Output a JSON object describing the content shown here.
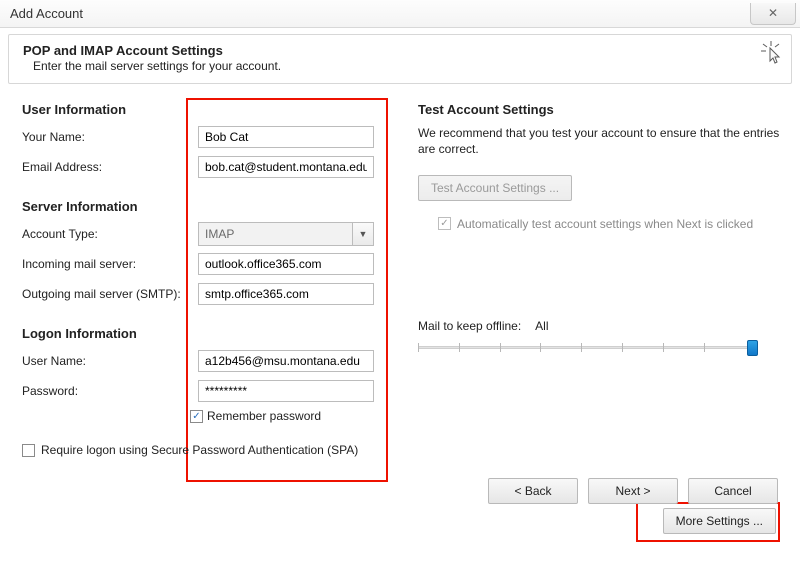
{
  "window": {
    "title": "Add Account",
    "close_glyph": "✕"
  },
  "header": {
    "title": "POP and IMAP Account Settings",
    "subtitle": "Enter the mail server settings for your account."
  },
  "left": {
    "user_info_title": "User Information",
    "your_name_label": "Your Name:",
    "your_name_value": "Bob Cat",
    "email_label": "Email Address:",
    "email_value": "bob.cat@student.montana.edu",
    "server_info_title": "Server Information",
    "account_type_label": "Account Type:",
    "account_type_value": "IMAP",
    "incoming_label": "Incoming mail server:",
    "incoming_value": "outlook.office365.com",
    "outgoing_label": "Outgoing mail server (SMTP):",
    "outgoing_value": "smtp.office365.com",
    "logon_info_title": "Logon Information",
    "username_label": "User Name:",
    "username_value": "a12b456@msu.montana.edu",
    "password_label": "Password:",
    "password_value": "*********",
    "remember_pw_label": "Remember password",
    "remember_pw_checked": true,
    "spa_label": "Require logon using Secure Password Authentication (SPA)",
    "spa_checked": false
  },
  "right": {
    "test_title": "Test Account Settings",
    "test_desc": "We recommend that you test your account to ensure that the entries are correct.",
    "test_btn": "Test Account Settings ...",
    "auto_test_label": "Automatically test account settings when Next is clicked",
    "auto_test_checked": true,
    "mail_keep_label": "Mail to keep offline:",
    "mail_keep_value": "All",
    "more_settings_btn": "More Settings ..."
  },
  "footer": {
    "back": "< Back",
    "next": "Next >",
    "cancel": "Cancel"
  }
}
